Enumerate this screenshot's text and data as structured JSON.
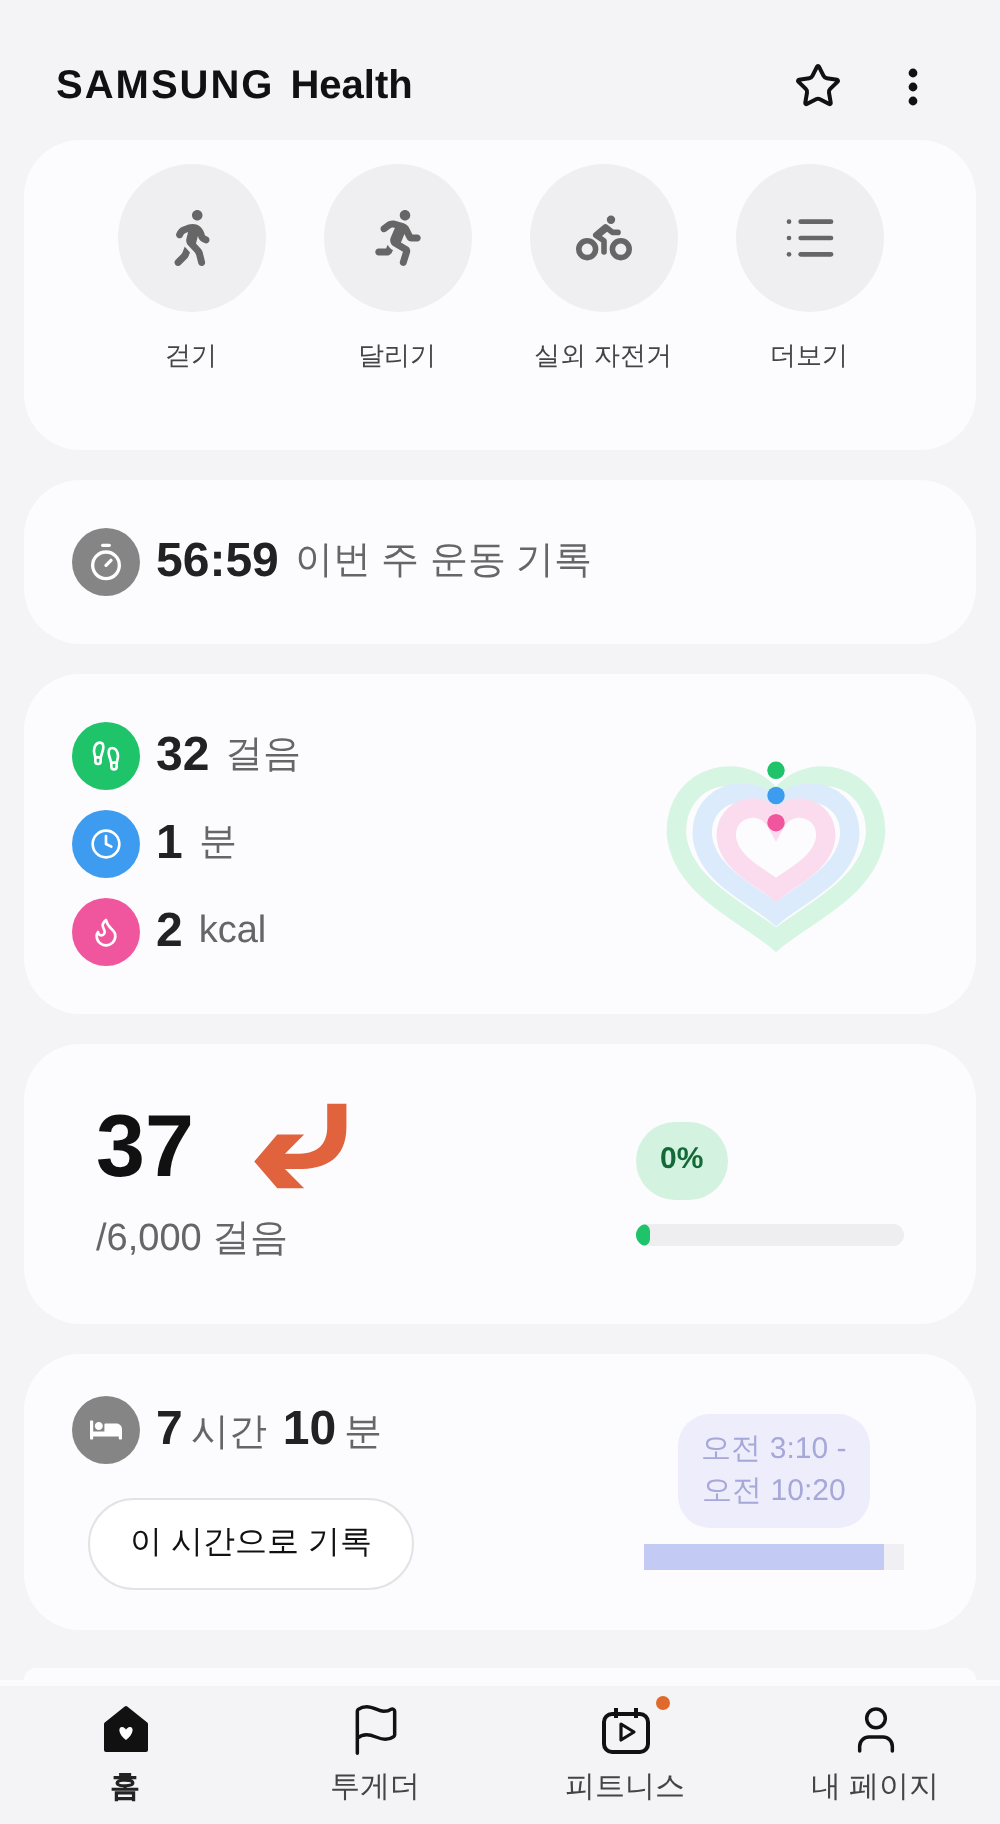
{
  "header": {
    "brand": "SAMSUNG",
    "product": "Health"
  },
  "quick_actions": [
    {
      "kind": "walk",
      "label": "걷기"
    },
    {
      "kind": "run",
      "label": "달리기"
    },
    {
      "kind": "bike",
      "label": "실외 자전거"
    },
    {
      "kind": "more",
      "label": "더보기"
    }
  ],
  "weekly_workout": {
    "time": "56:59",
    "label": "이번 주 운동 기록"
  },
  "activity": {
    "metrics": [
      {
        "kind": "steps",
        "value": "32",
        "unit": "걸음",
        "color": "#1fc46a"
      },
      {
        "kind": "time",
        "value": "1",
        "unit": "분",
        "color": "#3d9cf0"
      },
      {
        "kind": "calories",
        "value": "2",
        "unit": "kcal",
        "color": "#f0569d"
      }
    ]
  },
  "steps": {
    "value": "37",
    "goal": "/6,000 걸음",
    "percent": "0%",
    "level": 0.02
  },
  "sleep": {
    "hours": "7",
    "hours_unit": "시간",
    "minutes": "10",
    "minutes_unit": "분",
    "record_button": "이 시간으로 기록",
    "range_lines": [
      "오전 3:10 -",
      "오전 10:20"
    ],
    "level": 0.92
  },
  "bottom_nav": [
    {
      "kind": "home",
      "label": "홈",
      "selected": true,
      "badge": false
    },
    {
      "kind": "together",
      "label": "투게더",
      "selected": false,
      "badge": false
    },
    {
      "kind": "fitness",
      "label": "피트니스",
      "selected": false,
      "badge": true
    },
    {
      "kind": "profile",
      "label": "내 페이지",
      "selected": false,
      "badge": false
    }
  ]
}
